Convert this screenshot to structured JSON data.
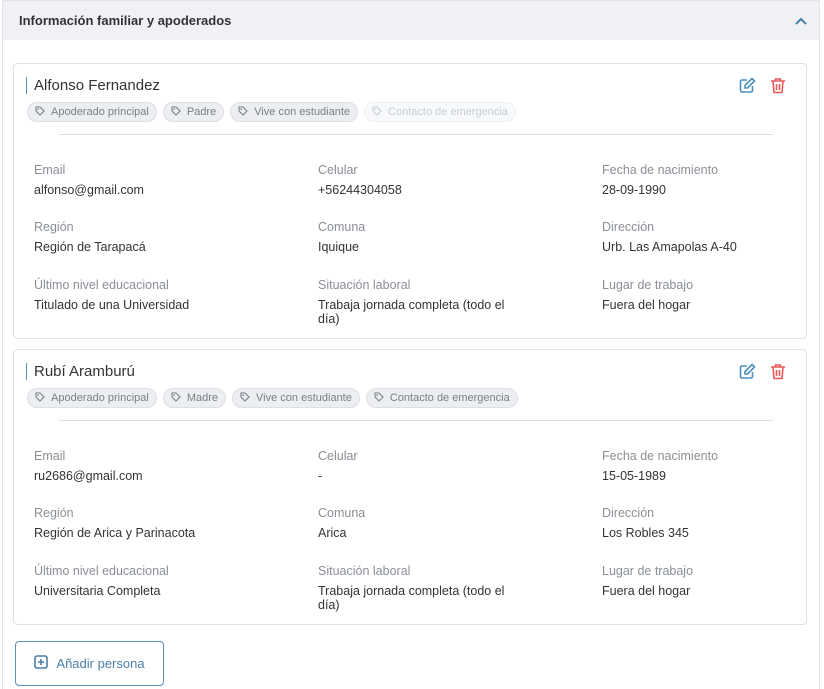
{
  "section": {
    "title": "Información familiar y apoderados"
  },
  "labels": {
    "email": "Email",
    "celular": "Celular",
    "fecha": "Fecha de nacimiento",
    "region": "Región",
    "comuna": "Comuna",
    "direccion": "Dirección",
    "nivel": "Último nivel educacional",
    "situacion": "Situación laboral",
    "lugar": "Lugar de trabajo"
  },
  "persons": [
    {
      "name": "Alfonso Fernandez",
      "tags": [
        {
          "label": "Apoderado principal",
          "active": true
        },
        {
          "label": "Padre",
          "active": true
        },
        {
          "label": "Vive con estudiante",
          "active": true
        },
        {
          "label": "Contacto de emergencia",
          "active": false
        }
      ],
      "email": "alfonso@gmail.com",
      "celular": "+56244304058",
      "fecha": "28-09-1990",
      "region": "Región de Tarapacá",
      "comuna": "Iquique",
      "direccion": "Urb. Las Amapolas A-40",
      "nivel": "Titulado de una Universidad",
      "situacion": "Trabaja jornada completa (todo el día)",
      "lugar": "Fuera del hogar"
    },
    {
      "name": "Rubí Aramburú",
      "tags": [
        {
          "label": "Apoderado principal",
          "active": true
        },
        {
          "label": "Madre",
          "active": true
        },
        {
          "label": "Vive con estudiante",
          "active": true
        },
        {
          "label": "Contacto de emergencia",
          "active": true
        }
      ],
      "email": "ru2686@gmail.com",
      "celular": "-",
      "fecha": "15-05-1989",
      "region": "Región de Arica y Parinacota",
      "comuna": "Arica",
      "direccion": "Los Robles 345",
      "nivel": "Universitaria Completa",
      "situacion": "Trabaja jornada completa (todo el día)",
      "lugar": "Fuera del hogar"
    }
  ],
  "add_button": {
    "label": "Añadir persona"
  },
  "colors": {
    "accent": "#4a7fa8",
    "danger": "#e85a5a"
  }
}
